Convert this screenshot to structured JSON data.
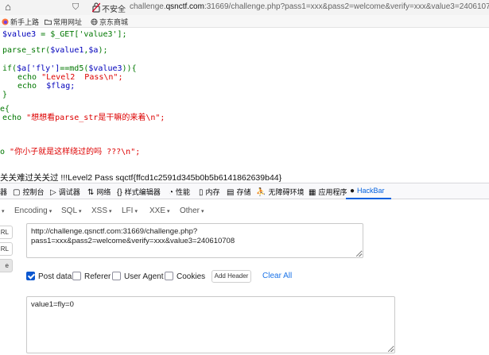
{
  "browser": {
    "home_glyph": "⌂",
    "shield_glyph": "⛉",
    "insecure_label": "不安全",
    "url_prefix": "challenge.",
    "url_domain": "qsnctf.com",
    "url_rest": ":31669/challenge.php?pass1=xxx&pass2=welcome&verify=xxx&value3=240610708",
    "bookmarks": [
      "新手上路",
      "常用网址",
      "京东商城"
    ]
  },
  "code": {
    "line1": [
      "$value3",
      " = ",
      "$_GET['value3'];"
    ],
    "line2": [
      "parse_str(",
      "$value1",
      ",",
      "$a",
      ");"
    ],
    "line3": [
      "if(",
      "$a['fly']",
      "==md5(",
      "$value3",
      ")){"
    ],
    "line4": [
      "echo ",
      "\"Level2  Pass\\n\";"
    ],
    "line5": [
      "echo  ",
      "$flag;"
    ],
    "line6": "}",
    "line7": "e{",
    "line8": [
      "echo ",
      "\"想想看parse_str是干嘛的来着\\n\";"
    ],
    "line9": [
      "o ",
      "\"你小子就是这样绕过的吗 ???\\n\";"
    ]
  },
  "output": {
    "flag_line": "关关难过关关过 !!!Level2 Pass sqctf{ffcd1c2591d345b0b5b6141862639b44}"
  },
  "devtools": {
    "tabs": [
      {
        "icon": "",
        "label": "器"
      },
      {
        "icon": "▢",
        "label": "控制台"
      },
      {
        "icon": "▷",
        "label": "调试器"
      },
      {
        "icon": "⇅",
        "label": "网络"
      },
      {
        "icon": "{}",
        "label": "样式编辑器"
      },
      {
        "icon": "◔",
        "label": "性能"
      },
      {
        "icon": "▯",
        "label": "内存"
      },
      {
        "icon": "▤",
        "label": "存储"
      },
      {
        "icon": "⛹",
        "label": "无障碍环境"
      },
      {
        "icon": "▦",
        "label": "应用程序"
      },
      {
        "icon": "●",
        "label": "HackBar"
      }
    ]
  },
  "hackbar": {
    "menus": [
      "Encoding",
      "SQL",
      "XSS",
      "LFI",
      "XXE",
      "Other"
    ],
    "side_buttons": [
      "RL",
      "RL",
      "e"
    ],
    "url_value": "http://challenge.qsnctf.com:31669/challenge.php?\npass1=xxx&pass2=welcome&verify=xxx&value3=240610708",
    "options": [
      {
        "label": "Post data",
        "checked": true
      },
      {
        "label": "Referer",
        "checked": false
      },
      {
        "label": "User Agent",
        "checked": false
      },
      {
        "label": "Cookies",
        "checked": false
      }
    ],
    "add_header_label": "Add Header",
    "clear_all_label": "Clear All",
    "post_value": "value1=fly=0"
  },
  "colors": {
    "code_keyword": "#007700",
    "code_variable": "#0000bb",
    "code_string": "#dd0000",
    "accent": "#0060df",
    "checkbox_on": "#0b57d0"
  }
}
